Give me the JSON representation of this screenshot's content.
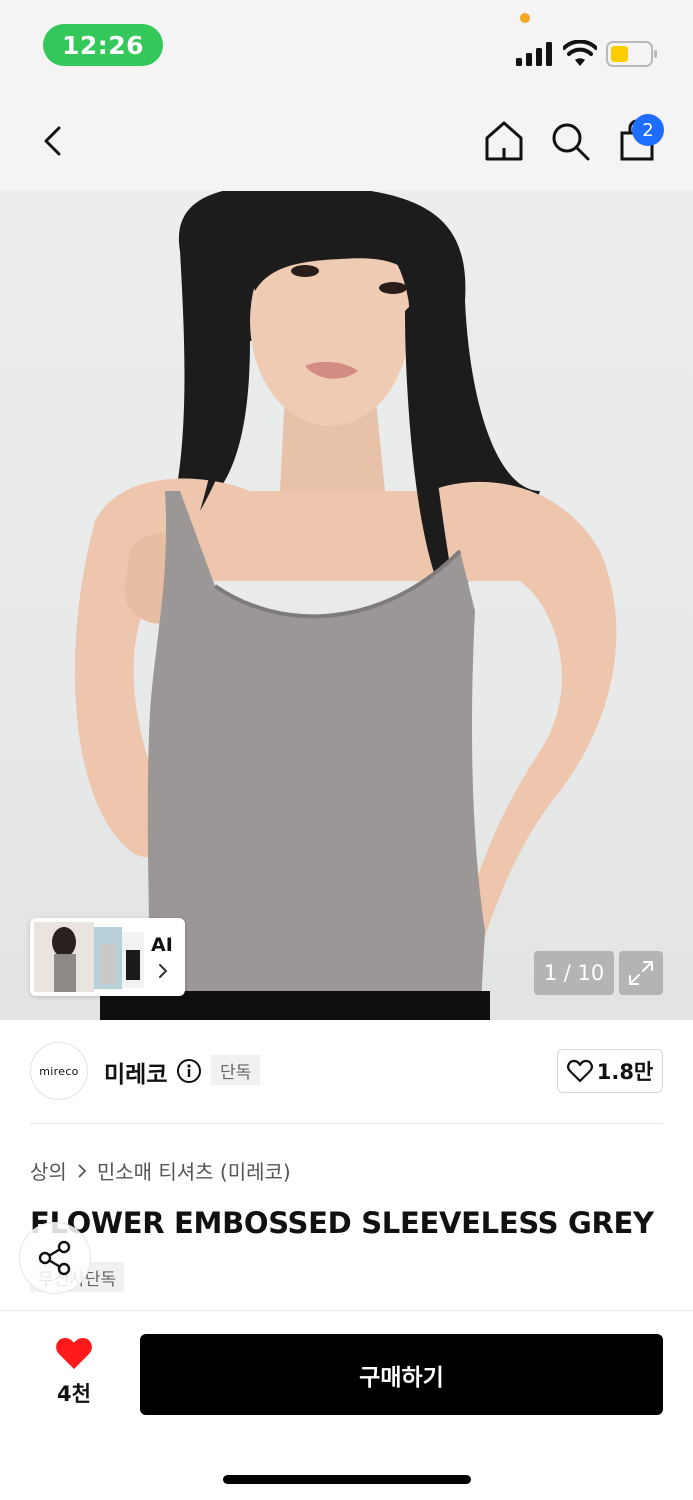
{
  "status_bar": {
    "time": "12:26",
    "icons": [
      "signal-icon",
      "wifi-icon",
      "battery-icon"
    ],
    "time_pill_color": "#34c759"
  },
  "nav": {
    "icons": [
      "back-icon",
      "home-icon",
      "search-icon",
      "shopping-bag-icon"
    ],
    "cart_badge": "2",
    "badge_color": "#1f6dff"
  },
  "gallery": {
    "ai_label": "AI",
    "counter": "1 / 10",
    "icons": [
      "chevron-right-icon",
      "expand-icon"
    ]
  },
  "brand": {
    "logo_text": "mireco",
    "name": "미레코",
    "exclusive_label": "단독",
    "like_count": "1.8만"
  },
  "product": {
    "breadcrumb": [
      "상의",
      "민소매 티셔츠 (미레코)"
    ],
    "title": "FLOWER EMBOSSED SLEEVELESS GREY",
    "tag": "무신사단독"
  },
  "bottom_bar": {
    "wish_count": "4천",
    "buy_label": "구매하기",
    "heart_color": "#ff1a1a",
    "buy_bg": "#000000"
  }
}
